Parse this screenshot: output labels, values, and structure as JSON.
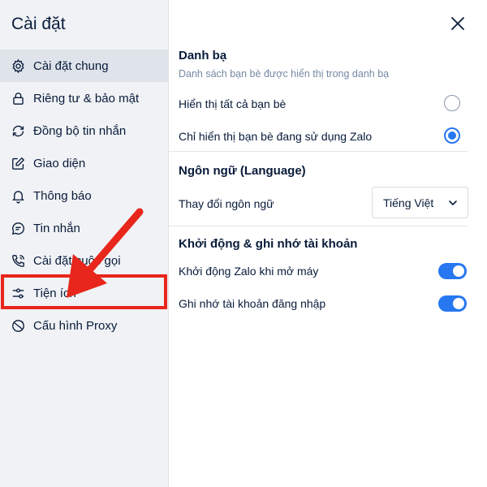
{
  "sidebar": {
    "title": "Cài đặt",
    "items": [
      {
        "label": "Cài đặt chung",
        "icon": "gear-icon"
      },
      {
        "label": "Riêng tư & bảo mật",
        "icon": "lock-icon"
      },
      {
        "label": "Đồng bộ tin nhắn",
        "icon": "sync-icon"
      },
      {
        "label": "Giao diện",
        "icon": "edit-icon"
      },
      {
        "label": "Thông báo",
        "icon": "bell-icon"
      },
      {
        "label": "Tin nhắn",
        "icon": "chat-icon"
      },
      {
        "label": "Cài đặt cuộc gọi",
        "icon": "phone-icon"
      },
      {
        "label": "Tiện ích",
        "icon": "sliders-icon"
      },
      {
        "label": "Cấu hình Proxy",
        "icon": "proxy-icon"
      }
    ]
  },
  "contacts": {
    "title": "Danh bạ",
    "subtitle": "Danh sách bạn bè được hiển thị trong danh bạ",
    "option_all": "Hiển thị tất cả bạn bè",
    "option_zalo": "Chỉ hiển thị bạn bè đang sử dụng Zalo"
  },
  "language": {
    "title": "Ngôn ngữ (Language)",
    "change_label": "Thay đổi ngôn ngữ",
    "selected": "Tiếng Việt"
  },
  "startup": {
    "title": "Khởi động & ghi nhớ tài khoản",
    "launch_label": "Khởi động Zalo khi mở máy",
    "remember_label": "Ghi nhớ tài khoản đăng nhập"
  },
  "colors": {
    "accent": "#2777f1",
    "annotation": "#e8261b"
  }
}
